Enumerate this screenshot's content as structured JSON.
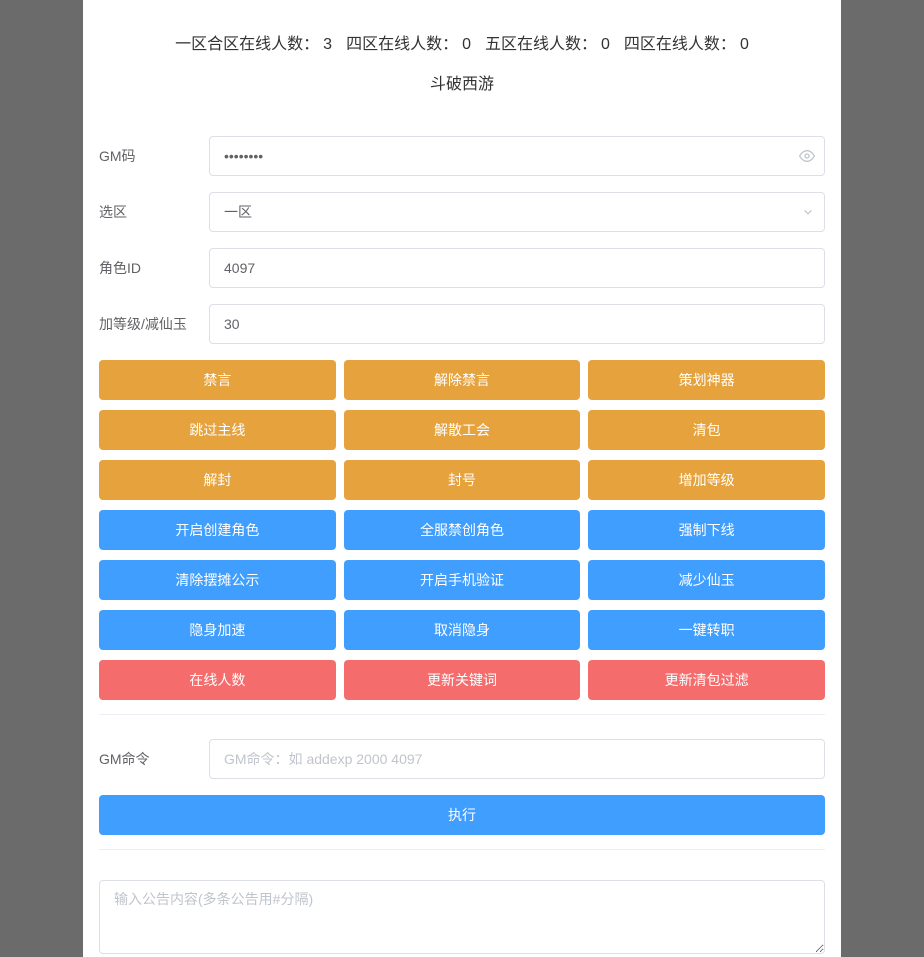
{
  "header": {
    "stats": [
      {
        "label": "一区合区在线人数：",
        "value": 3
      },
      {
        "label": "四区在线人数：",
        "value": 0
      },
      {
        "label": "五区在线人数：",
        "value": 0
      },
      {
        "label": "四区在线人数：",
        "value": 0
      }
    ],
    "game_title": "斗破西游"
  },
  "form": {
    "gm_code": {
      "label": "GM码",
      "value": "••••••••"
    },
    "zone": {
      "label": "选区",
      "value": "一区"
    },
    "role_id": {
      "label": "角色ID",
      "value": "4097"
    },
    "level_gem": {
      "label": "加等级/减仙玉",
      "value": "30"
    }
  },
  "buttons": {
    "orange": [
      "禁言",
      "解除禁言",
      "策划神器",
      "跳过主线",
      "解散工会",
      "清包",
      "解封",
      "封号",
      "增加等级"
    ],
    "blue": [
      "开启创建角色",
      "全服禁创角色",
      "强制下线",
      "清除摆摊公示",
      "开启手机验证",
      "减少仙玉",
      "隐身加速",
      "取消隐身",
      "一键转职"
    ],
    "red": [
      "在线人数",
      "更新关键词",
      "更新清包过滤"
    ]
  },
  "gm_command": {
    "label": "GM命令",
    "placeholder": "GM命令：如 addexp 2000 4097",
    "execute_label": "执行"
  },
  "announcement": {
    "placeholder": "输入公告内容(多条公告用#分隔)"
  }
}
